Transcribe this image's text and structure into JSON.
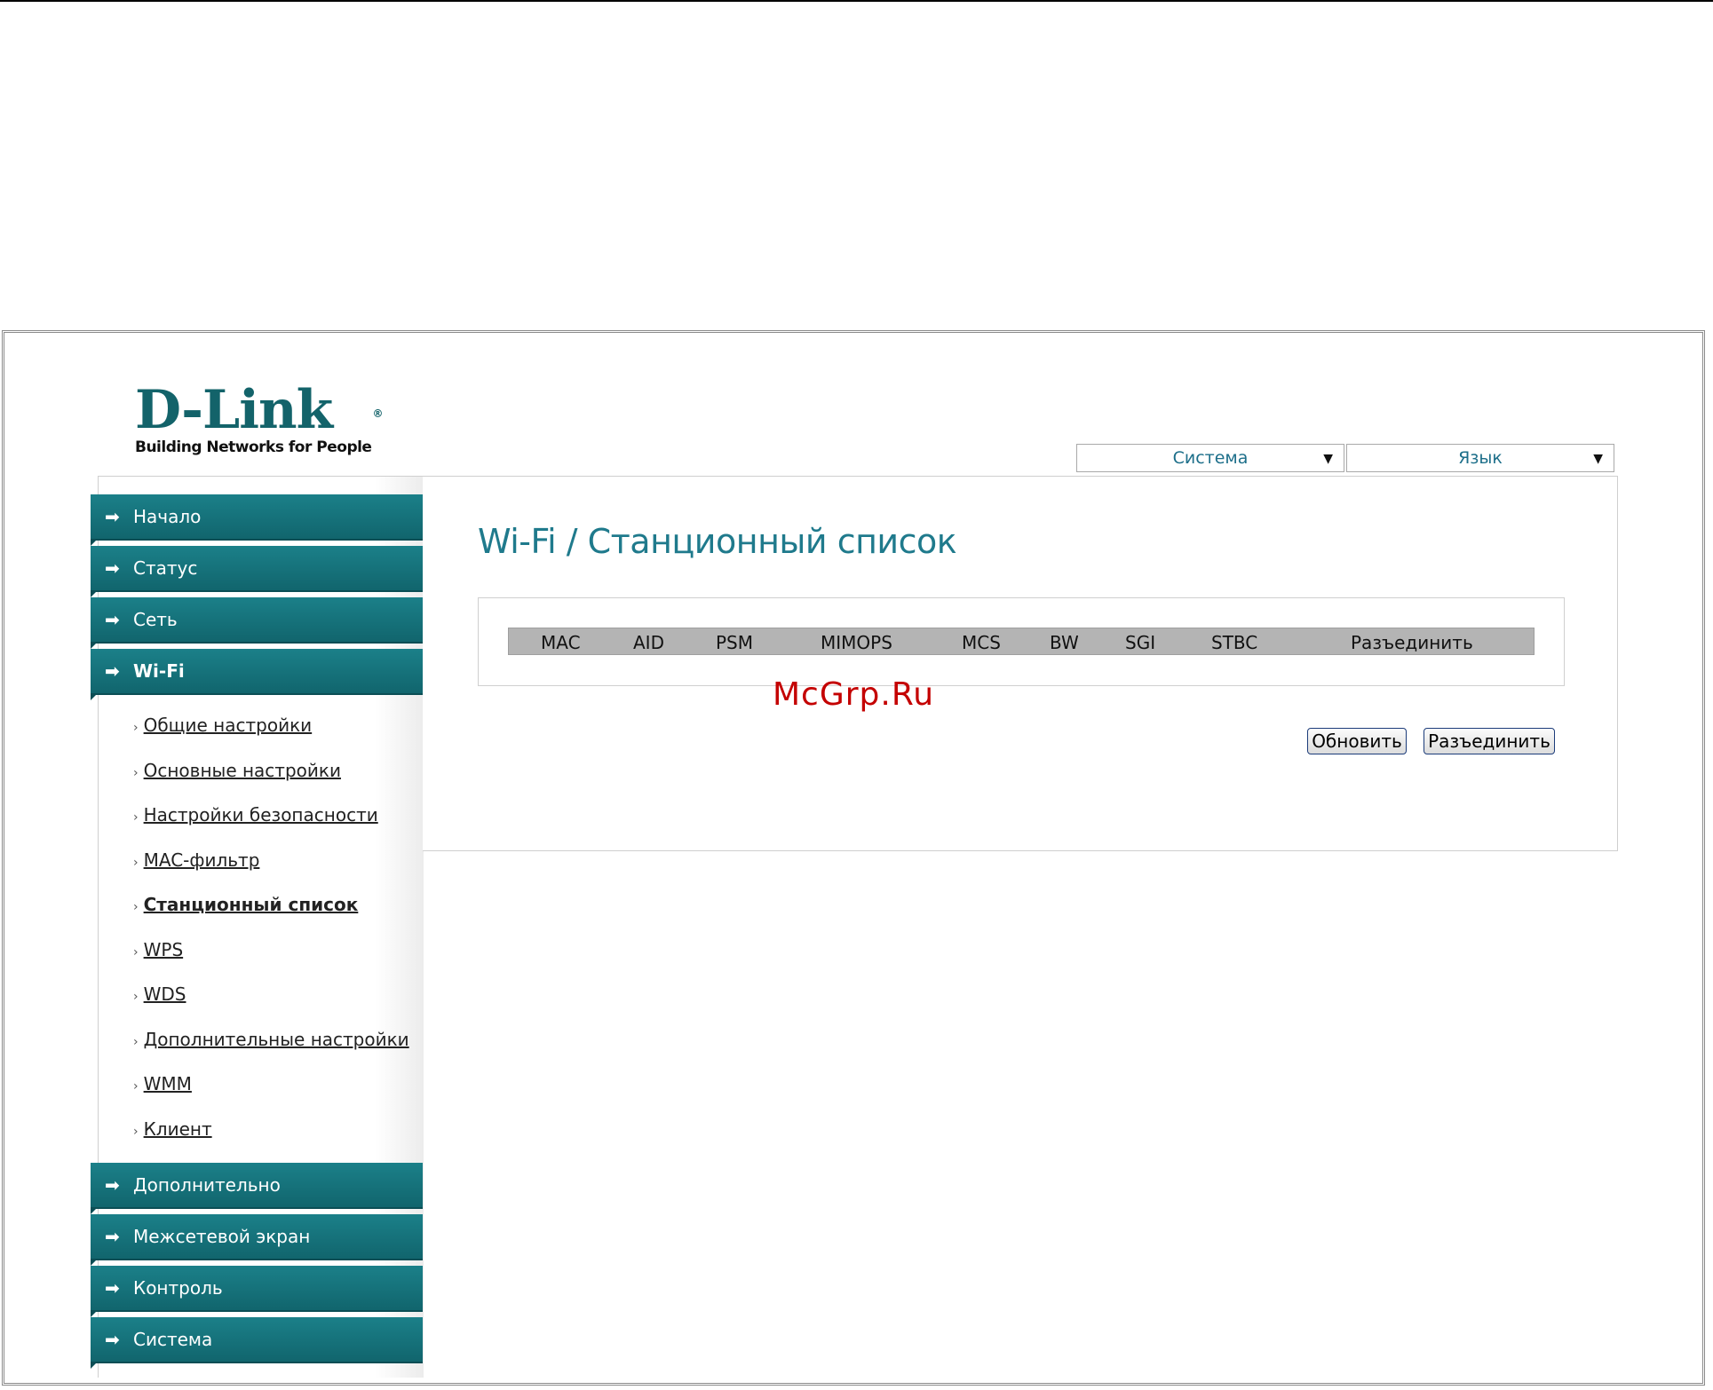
{
  "logo": {
    "brand": "D-Link",
    "tagline": "Building Networks for People"
  },
  "dropdowns": [
    {
      "label": "Система"
    },
    {
      "label": "Язык"
    }
  ],
  "nav": {
    "top_items": [
      {
        "label": "Начало"
      },
      {
        "label": "Статус"
      },
      {
        "label": "Сеть"
      },
      {
        "label": "Wi-Fi",
        "active": true
      }
    ],
    "sub_items": [
      {
        "label": "Общие настройки"
      },
      {
        "label": "Основные настройки"
      },
      {
        "label": "Настройки безопасности"
      },
      {
        "label": "MAC-фильтр"
      },
      {
        "label": "Станционный список",
        "current": true
      },
      {
        "label": "WPS"
      },
      {
        "label": "WDS"
      },
      {
        "label": "Дополнительные настройки"
      },
      {
        "label": "WMM"
      },
      {
        "label": "Клиент"
      }
    ],
    "bottom_items": [
      {
        "label": "Дополнительно"
      },
      {
        "label": "Межсетевой экран"
      },
      {
        "label": "Контроль"
      },
      {
        "label": "Система"
      }
    ]
  },
  "page": {
    "title": "Wi-Fi / Станционный список"
  },
  "table": {
    "columns": [
      "MAC",
      "AID",
      "PSM",
      "MIMOPS",
      "MCS",
      "BW",
      "SGI",
      "STBC",
      "Разъединить"
    ],
    "rows": []
  },
  "buttons": {
    "refresh": "Обновить",
    "disconnect": "Разъединить"
  },
  "watermark": "McGrp.Ru",
  "colors": {
    "accent": "#13636a",
    "nav_bg": "#1b8089",
    "title": "#1f7a8c"
  }
}
